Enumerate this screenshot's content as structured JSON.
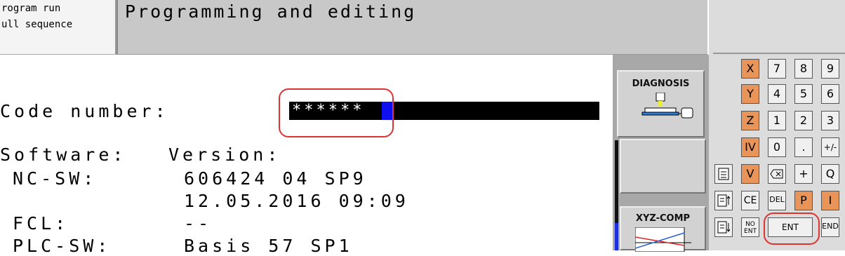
{
  "header": {
    "mode_line1": "rogram run",
    "mode_line2": "ull sequence",
    "title": "Programming and editing"
  },
  "main": {
    "code_label": "Code number:",
    "code_value": "******",
    "software_label": "Software:",
    "version_label": "Version:",
    "nc_sw_label": "NC-SW:",
    "nc_sw_version": "606424 04 SP9",
    "nc_sw_date": "12.05.2016 09:09",
    "fcl_label": "FCL:",
    "fcl_value": "--",
    "plc_sw_label": "PLC-SW:",
    "plc_sw_value": "Basis 57 SP1"
  },
  "softkeys": {
    "diagnosis": "DIAGNOSIS",
    "xyz_comp": "XYZ-COMP"
  },
  "keyboard": {
    "x": "X",
    "y": "Y",
    "z": "Z",
    "iv": "IV",
    "v": "V",
    "k7": "7",
    "k8": "8",
    "k9": "9",
    "k4": "4",
    "k5": "5",
    "k6": "6",
    "k1": "1",
    "k2": "2",
    "k3": "3",
    "k0": "0",
    "dot": ".",
    "plusminus": "+/-",
    "plus": "+",
    "q": "Q",
    "ce": "CE",
    "del": "DEL",
    "p": "P",
    "i": "I",
    "no_ent": "NO ENT",
    "ent": "ENT",
    "end": "END"
  },
  "colors": {
    "orange_key": "#e9955a",
    "annotation": "#dd3333",
    "cursor": "#1010ee"
  }
}
